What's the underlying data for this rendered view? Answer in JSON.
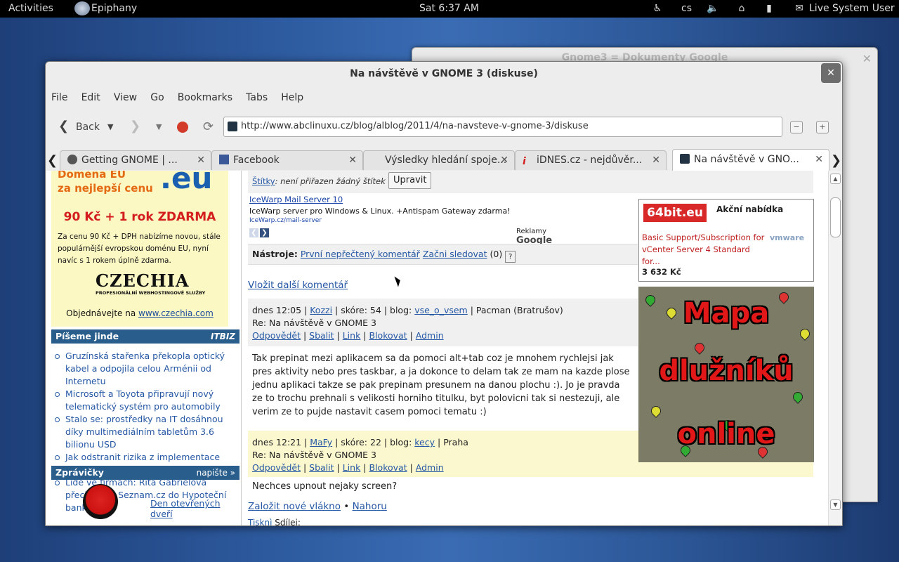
{
  "topbar": {
    "activities": "Activities",
    "app": "Epiphany",
    "clock": "Sat  6:37 AM",
    "lang": "cs",
    "user": "Live System User"
  },
  "bg_window": {
    "title": "Gnome3 = Dokumenty Google"
  },
  "window": {
    "title": "Na návštěvě v GNOME 3 (diskuse)",
    "menu": [
      "File",
      "Edit",
      "View",
      "Go",
      "Bookmarks",
      "Tabs",
      "Help"
    ],
    "back_label": "Back",
    "url": "http://www.abclinuxu.cz/blog/alblog/2011/4/na-navsteve-v-gnome-3/diskuse",
    "tabs": [
      {
        "label": "Getting GNOME | ..."
      },
      {
        "label": "Facebook"
      },
      {
        "label": "Výsledky hledání spoje..."
      },
      {
        "label": "iDNES.cz - nejdůvěr..."
      },
      {
        "label": "Na návštěvě v GNO..."
      }
    ]
  },
  "left": {
    "ad": {
      "line1": "Doména EU",
      "line2": "za nejlepší cenu",
      "big": ".eu",
      "price": "90 Kč + 1 rok ZDARMA",
      "desc": "Za cenu 90 Kč + DPH nabízíme novou, stále populárnější evropskou doménu EU, nyní navíc s 1 rokem úplně zdarma.",
      "logo": "CZECHIA",
      "logo_sub": "PROFESIONÁLNÍ WEBHOSTINGOVÉ SLUŽBY",
      "order_prefix": "Objednávejte na ",
      "order_link": "www.czechia.com"
    },
    "piseme": {
      "title": "Píšeme jinde",
      "tag": "ITBIZ",
      "items": [
        "Gruzínská stařenka překopla optický kabel a odpojila celou Arménii od Internetu",
        "Microsoft a Toyota připravují nový telematický systém pro automobily",
        "Stalo se: prostředky na IT dosáhnou díky multimediálním tabletům 3.6 bilionu USD",
        "Jak odstranit rizika z implementace ERP?",
        "Lidé ve firmách: Rita Gabrielová přechází ze Seznam.cz do Hypoteční banky"
      ]
    },
    "zpravicky": {
      "title": "Zprávičky",
      "action": "napište »",
      "link": "Den otevřených dveří"
    }
  },
  "main": {
    "stitky_label": "Štítky",
    "stitky_text": ": není přiřazen žádný štítek",
    "upravit": "Upravit",
    "gad": {
      "title": "IceWarp Mail Server 10",
      "desc": "IceWarp server pro Windows & Linux. +Antispam Gateway zdarma!",
      "url": "IceWarp.cz/mail-server",
      "reklamy": "Reklamy",
      "google": "Google"
    },
    "nastroje": {
      "label": "Nástroje:",
      "link1": "První nepřečtený komentář",
      "link2": "Začni sledovat",
      "count": "(0)",
      "help": "?"
    },
    "vlozit": "Vložit další komentář",
    "comments": [
      {
        "time": "dnes 12:05",
        "author": "Kozzi",
        "score": "skóre: 54",
        "blog_label": "blog:",
        "blog": "vse_o_vsem",
        "place": "Pacman (Bratrušov)",
        "subject": "Re: Na návštěvě v GNOME 3",
        "text": "Tak prepinat mezi aplikacem sa da pomoci alt+tab coz je mnohem rychlejsi jak pres aktivity nebo pres taskbar, a ja dokonce to delam tak ze mam na kazde plose jednu aplikaci takze se pak prepinam presunem na danou plochu :). Jo je pravda ze to trochu prehnali s velikosti horniho titulku, byt polovicni tak si nestezuji, ale verim ze to pujde nastavit casem pomoci tematu :)"
      },
      {
        "time": "dnes 12:21",
        "author": "MaFy",
        "score": "skóre: 22",
        "blog_label": "blog:",
        "blog": "kecy",
        "place": "Praha",
        "subject": "Re: Na návštěvě v GNOME 3",
        "text": "Nechces upnout nejaky screen?"
      }
    ],
    "actions": [
      "Odpovědět",
      "Sbalit",
      "Link",
      "Blokovat",
      "Admin"
    ],
    "zalozit": "Založit nové vlákno",
    "nahoru": "Nahoru",
    "tisk": "Tisknì",
    "sdilej": "Sdílej:",
    "right_ad": {
      "brand": "64bit.eu",
      "offer": "Akční nabídka",
      "desc": "Basic Support/Subscription for vCenter Server 4 Standard for...",
      "vendor": "vmware",
      "price": "3 632 Kč"
    },
    "map": {
      "line1": "Mapa",
      "line2": "dlužníků",
      "line3": "online"
    }
  }
}
